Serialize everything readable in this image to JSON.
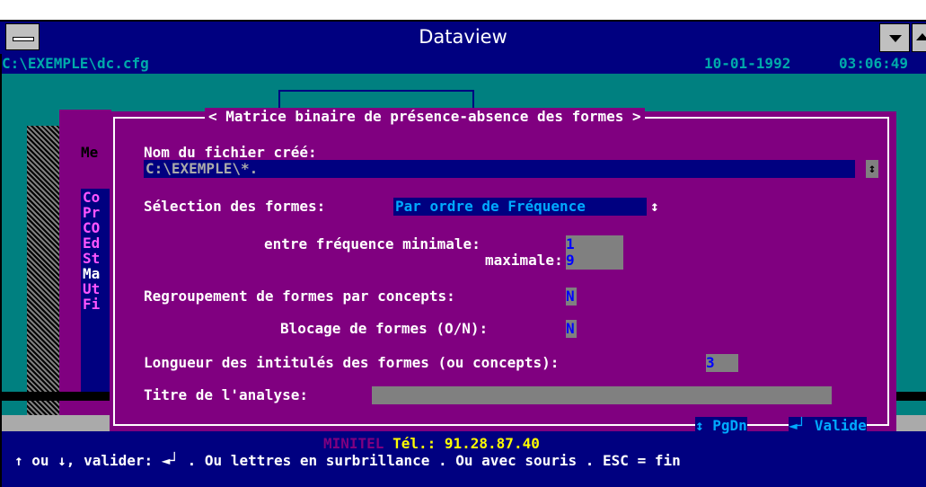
{
  "window": {
    "title": "Dataview"
  },
  "status": {
    "path": "C:\\EXEMPLE\\dc.cfg",
    "date": "10-01-1992",
    "time": "03:06:49"
  },
  "underlying_menu": {
    "title": "Me",
    "items": [
      "Co",
      "Pr",
      "CO",
      "Ed",
      "St",
      "Ma",
      "Ut",
      "Fi"
    ]
  },
  "dialog": {
    "title": "< Matrice binaire de présence-absence des formes >",
    "file_label": "Nom du fichier créé:",
    "file_value": "C:\\EXEMPLE\\*.",
    "selection_label": "Sélection des formes:",
    "selection_value": "Par ordre de Fréquence",
    "freq_min_label": "entre fréquence minimale:",
    "freq_min_value": "1",
    "freq_max_label": "maximale:",
    "freq_max_value": "9",
    "regroup_label": "Regroupement de formes par concepts:",
    "regroup_value": "N",
    "blocage_label": "Blocage de formes (O/N):",
    "blocage_value": "N",
    "longueur_label": "Longueur des intitulés des formes (ou concepts):",
    "longueur_value": "3",
    "titre_label": "Titre de l'analyse:",
    "titre_value": "",
    "pgdn_label": "↕ PgDn",
    "valide_label": "◄┘ Valide"
  },
  "footer": {
    "minitel_label": "MINITEL",
    "minitel_phone": "Tél.: 91.28.87.40",
    "help_text": "↑ ou ↓, valider: ◄┘ . Ou lettres en surbrillance . Ou avec souris . ESC = fin"
  },
  "colors": {
    "titlebar": "#000080",
    "desktop": "#008080",
    "dialog": "#800080",
    "field": "#808080"
  }
}
